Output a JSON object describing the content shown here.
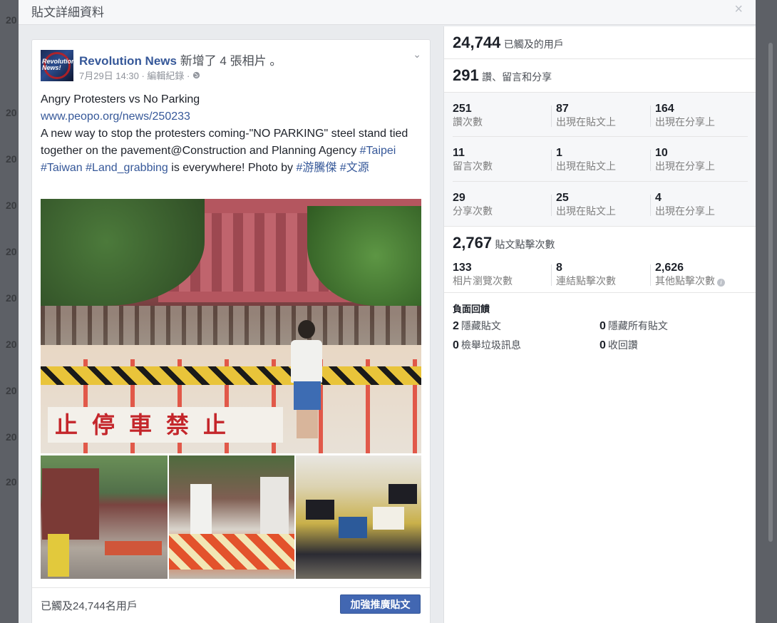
{
  "dialog": {
    "title": "貼文詳細資料",
    "close_glyph": "×"
  },
  "background_page": {
    "left_fragments": [
      "20",
      "20",
      "20",
      "20",
      "20",
      "20",
      "20",
      "20",
      "20",
      "20"
    ]
  },
  "post": {
    "page_name": "Revolution News",
    "action_text": " 新增了 4 張相片 。",
    "timestamp": "7月29日 14:30",
    "edit_history": " · 編輯紀錄 · ",
    "privacy_icon": "globe-icon",
    "logo_text": "Revolution News!",
    "body": {
      "line1": "Angry Protesters vs No Parking",
      "link": "www.peopo.org/news/250233",
      "line3": "A new way to stop the protesters coming-\"NO PARKING\" steel stand tied together on the pavement@Construction and Planning Agency ",
      "hashtags": "#Taipei #Taiwan #Land_grabbing",
      "tail": " is everywhere! Photo by ",
      "credit": "#游騰傑 #文源"
    },
    "photo_sign": "止停車禁止",
    "reach_text": "已觸及24,744名用戶",
    "boost_label": "加強推廣貼文"
  },
  "insights": {
    "reach": {
      "value": "24,744",
      "label": "已觸及的用戶"
    },
    "engagement": {
      "value": "291",
      "label": "讚、留言和分享"
    },
    "breakdown": [
      {
        "total": "251",
        "total_label": "讚次數",
        "on_post": "87",
        "on_post_label": "出現在貼文上",
        "on_shares": "164",
        "on_shares_label": "出現在分享上"
      },
      {
        "total": "11",
        "total_label": "留言次數",
        "on_post": "1",
        "on_post_label": "出現在貼文上",
        "on_shares": "10",
        "on_shares_label": "出現在分享上"
      },
      {
        "total": "29",
        "total_label": "分享次數",
        "on_post": "25",
        "on_post_label": "出現在貼文上",
        "on_shares": "4",
        "on_shares_label": "出現在分享上"
      }
    ],
    "clicks": {
      "value": "2,767",
      "label": "貼文點擊次數",
      "photo": "133",
      "photo_label": "相片瀏覽次數",
      "link": "8",
      "link_label": "連結點擊次數",
      "other": "2,626",
      "other_label": "其他點擊次數"
    },
    "negative": {
      "title": "負面回饋",
      "hide_post": "2",
      "hide_post_label": "隱藏貼文",
      "hide_all": "0",
      "hide_all_label": "隱藏所有貼文",
      "spam": "0",
      "spam_label": "檢舉垃圾訊息",
      "unlike": "0",
      "unlike_label": "收回讚"
    }
  }
}
